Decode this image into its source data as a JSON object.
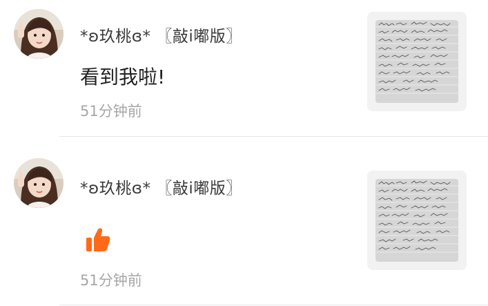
{
  "notifications": [
    {
      "username": "*ʚ玖桃ɞ* 〖敲i嘟版〗",
      "comment": "看到我啦!",
      "time": "51分钟前",
      "has_like_icon": false
    },
    {
      "username": "*ʚ玖桃ɞ* 〖敲i嘟版〗",
      "comment": "",
      "time": "51分钟前",
      "has_like_icon": true
    }
  ],
  "colors": {
    "like": "#ff6a1a",
    "time": "#a6a6a6",
    "divider": "#e6e6e6"
  },
  "icons": {
    "like": "thumbs-up-icon"
  }
}
